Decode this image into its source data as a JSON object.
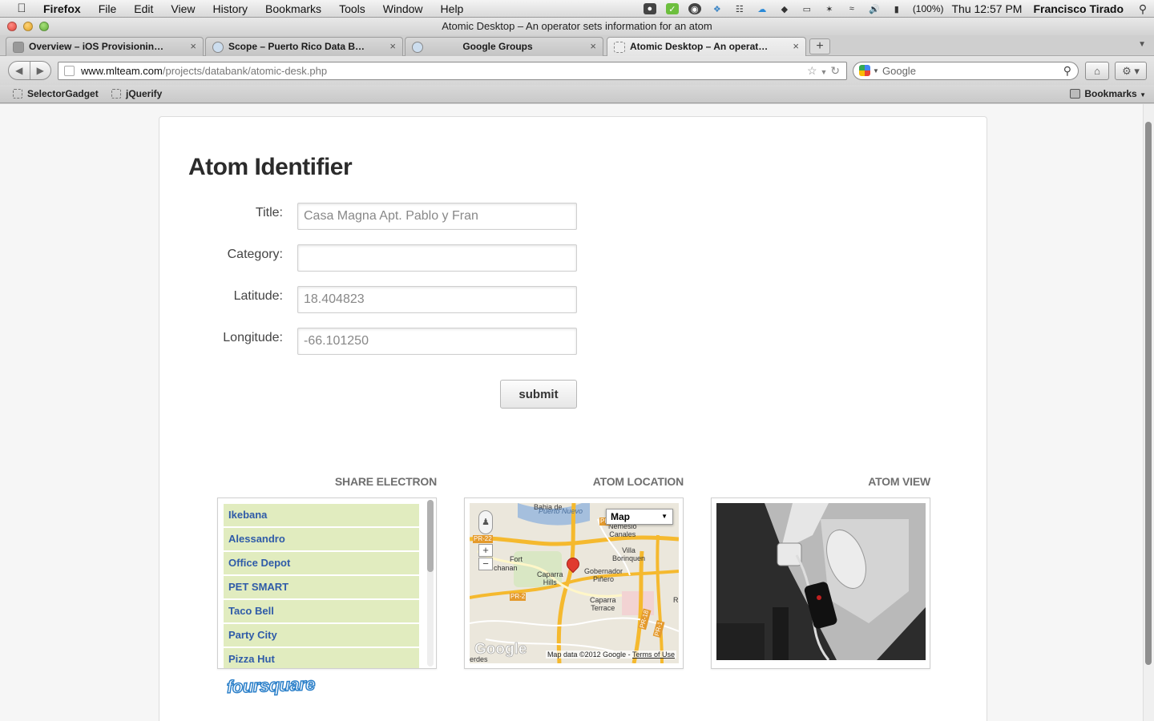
{
  "menubar": {
    "app_name": "Firefox",
    "menus": [
      "File",
      "Edit",
      "View",
      "History",
      "Bookmarks",
      "Tools",
      "Window",
      "Help"
    ],
    "battery": "(100%)",
    "clock": "Thu 12:57 PM",
    "user": "Francisco Tirado"
  },
  "window": {
    "title": "Atomic Desktop – An operator sets information for an atom"
  },
  "tabs": [
    {
      "label": "Overview – iOS Provisioning Po..."
    },
    {
      "label": "Scope – Puerto Rico Data Bank |..."
    },
    {
      "label": "Google Groups"
    },
    {
      "label": "Atomic Desktop – An operator ..."
    }
  ],
  "toolbar": {
    "url_domain": "www.mlteam.com",
    "url_path": "/projects/databank/atomic-desk.php",
    "search_placeholder": "Google"
  },
  "bookmarks": {
    "items": [
      "SelectorGadget",
      "jQuerify"
    ],
    "menu_label": "Bookmarks"
  },
  "page": {
    "title": "Atom Identifier",
    "form": {
      "title_label": "Title:",
      "title_value": "Casa Magna Apt. Pablo y Fran",
      "category_label": "Category:",
      "category_value": "",
      "latitude_label": "Latitude:",
      "latitude_value": "18.404823",
      "longitude_label": "Longitude:",
      "longitude_value": "-66.101250",
      "submit_label": "submit"
    },
    "sections": {
      "share": "SHARE ELECTRON",
      "location": "ATOM LOCATION",
      "view": "ATOM VIEW"
    },
    "venues": [
      "Ikebana",
      "Alessandro",
      "Office Depot",
      "PET SMART",
      "Taco Bell",
      "Party City",
      "Pizza Hut"
    ],
    "foursquare_logo": "foursquare",
    "map": {
      "type_label": "Map",
      "labels": {
        "puerto_nuevo": "Puerto Nuevo",
        "bahia": "Bahia de",
        "nemesio": "Nemesio\nCanales",
        "villa": "Villa\nBorinquen",
        "fort": "Fort",
        "buchanan": "chanan",
        "caparra_hills": "Caparra\nHills",
        "gobernador": "Gobernador\nPiñero",
        "caparra_terrace": "Caparra\nTerrace",
        "pr22": "PR-22",
        "pr2": "PR-2",
        "pr18": "PR-18",
        "pr1": "PR-1",
        "pr_top": "PR",
        "r_edge": "R",
        "verdes": "erdes"
      },
      "google_logo": "Google",
      "attribution": "Map data ©2012 Google - ",
      "terms": "Terms of Use"
    }
  }
}
